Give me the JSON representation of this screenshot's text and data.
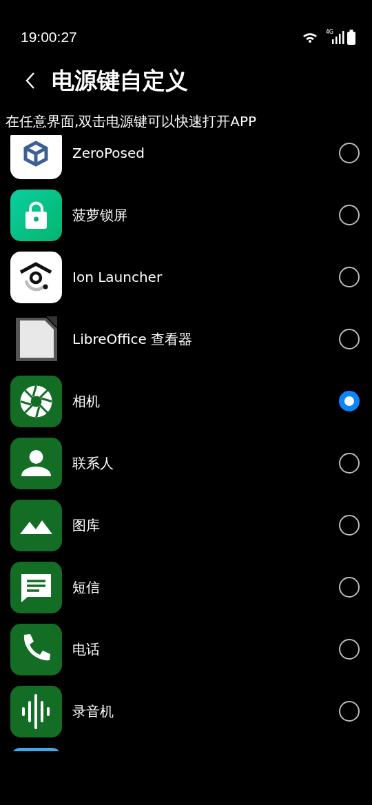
{
  "status_bar": {
    "time": "19:00:27",
    "network": "4G"
  },
  "header": {
    "title": "电源键自定义"
  },
  "description": "在任意界面,双击电源键可以快速打开APP",
  "apps": [
    {
      "kind": "app",
      "label": "ZeroPosed",
      "selected": false
    },
    {
      "kind": "app",
      "label": "菠萝锁屏",
      "selected": false
    },
    {
      "kind": "app",
      "label": "Ion Launcher",
      "selected": false
    },
    {
      "kind": "app",
      "label": "LibreOffice 查看器",
      "selected": false
    },
    {
      "kind": "app",
      "label": "相机",
      "selected": true
    },
    {
      "kind": "app",
      "label": "联系人",
      "selected": false
    },
    {
      "kind": "app",
      "label": "图库",
      "selected": false
    },
    {
      "kind": "app",
      "label": "短信",
      "selected": false
    },
    {
      "kind": "app",
      "label": "电话",
      "selected": false
    },
    {
      "kind": "app",
      "label": "录音机",
      "selected": false
    },
    {
      "kind": "partial"
    }
  ]
}
